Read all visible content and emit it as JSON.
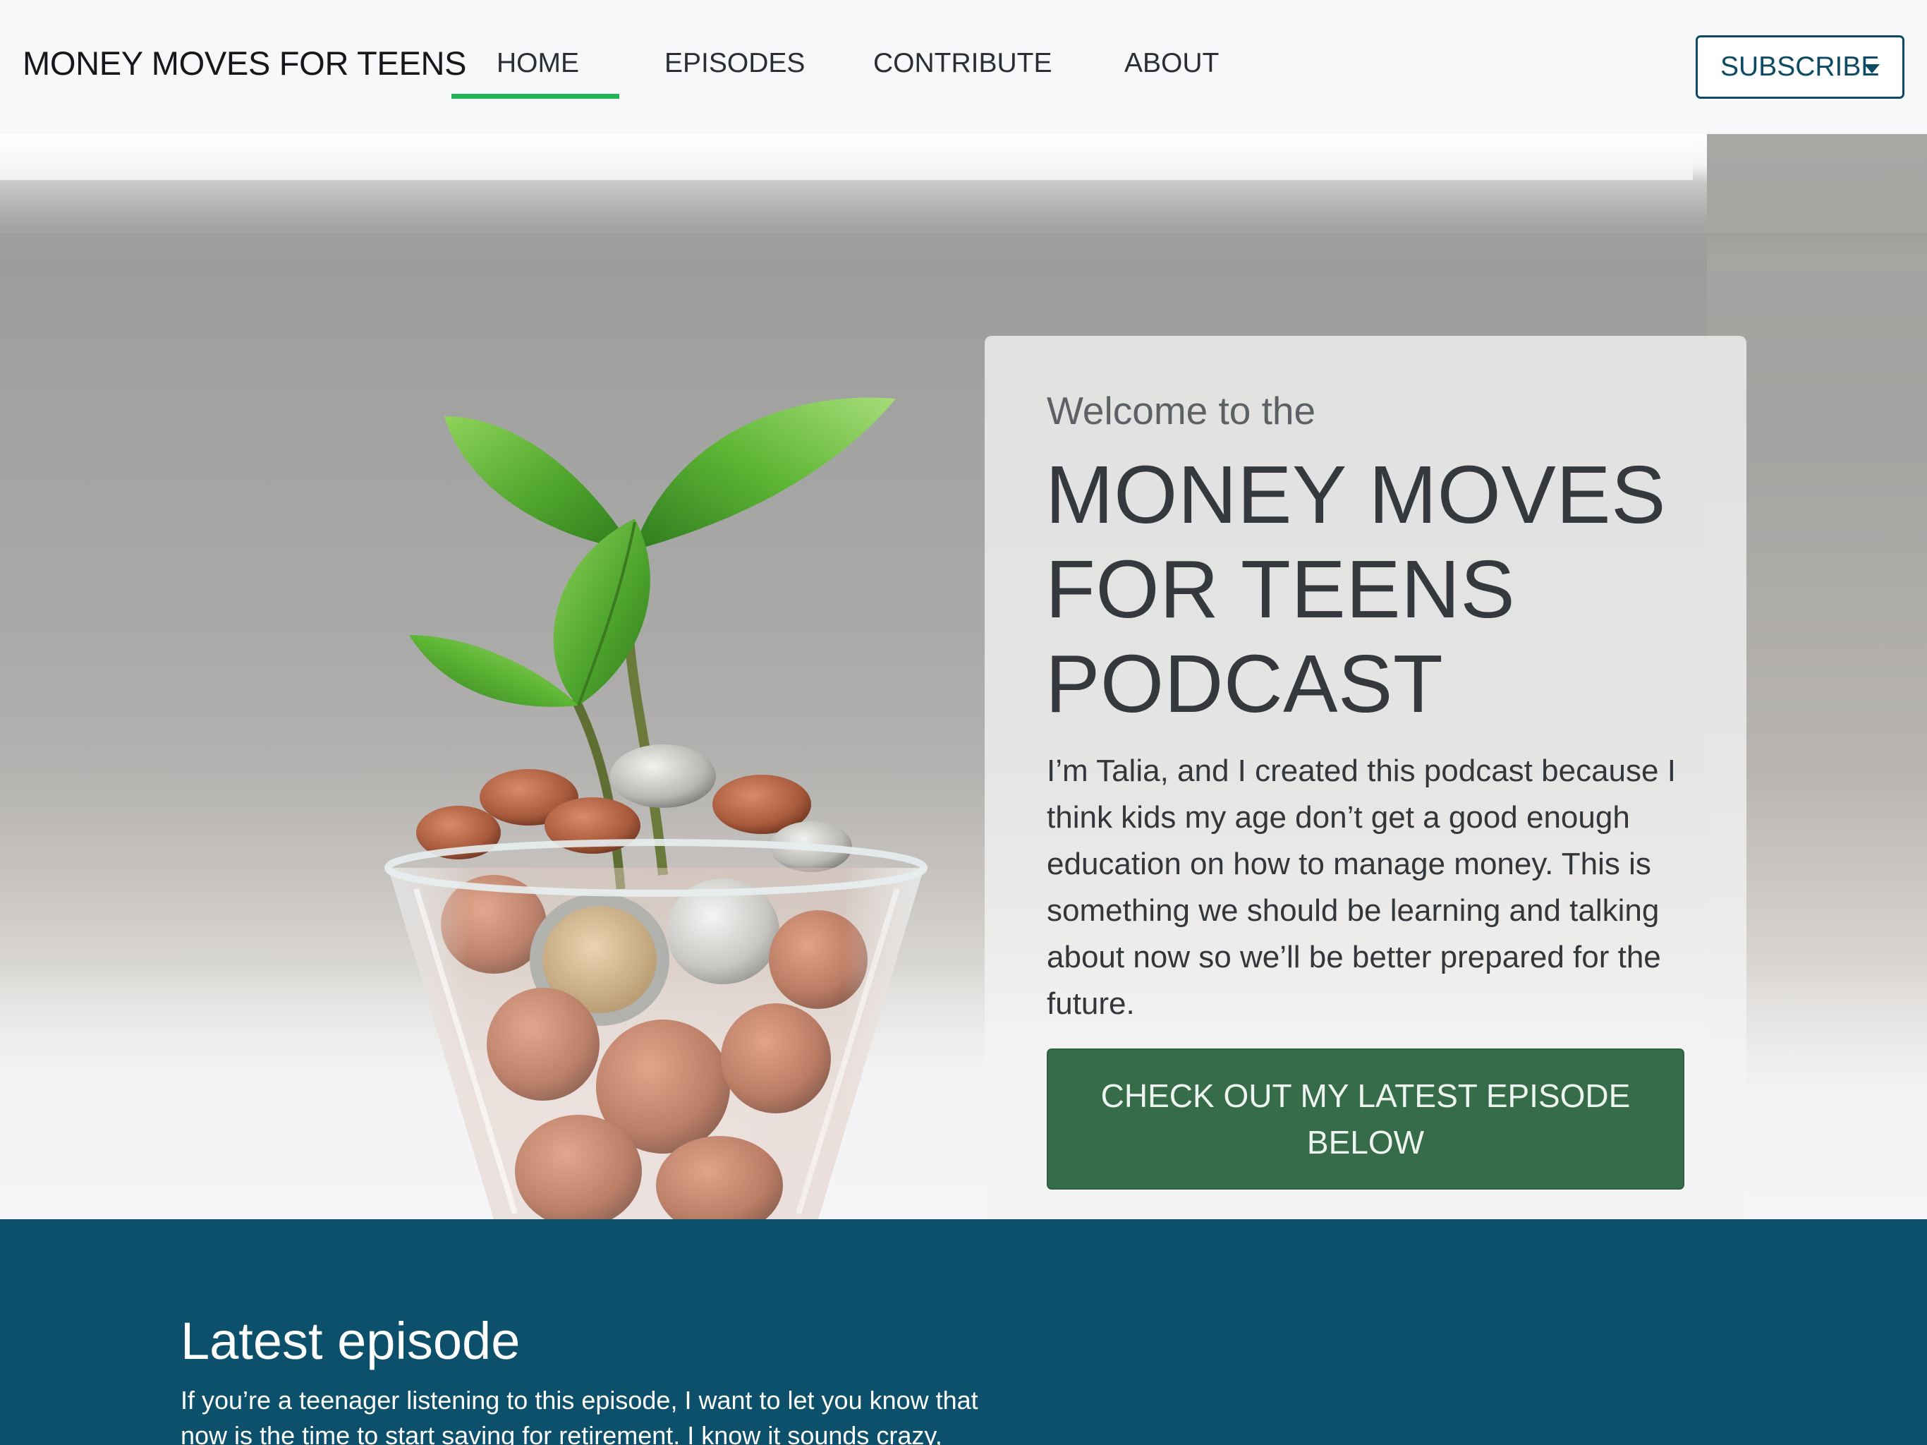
{
  "navbar": {
    "brand": "MONEY MOVES FOR TEENS",
    "links": [
      "HOME",
      "EPISODES",
      "CONTRIBUTE",
      "ABOUT"
    ],
    "active": "HOME",
    "subscribe_label": "SUBSCRIBE"
  },
  "hero": {
    "welcome": "Welcome to the",
    "title_lines": [
      "MONEY MOVES",
      "FOR TEENS",
      "PODCAST"
    ],
    "description": "I’m Talia, and I created this podcast because I think kids my age don’t get a good enough education on how to manage money. This is something we should be learning and talking about now so we’ll be better prepared for the future.",
    "cta_label": "CHECK OUT MY LATEST EPISODE BELOW",
    "image_icon": "plant-growing-from-coins-jar"
  },
  "latest_episode": {
    "heading": "Latest episode",
    "text": "If you’re a teenager listening to this episode, I want to let you know that now is the time to start saving for retirement. I know it sounds crazy,"
  },
  "colors": {
    "accent_underline": "#22b45a",
    "subscribe": "#0d4a63",
    "cta": "#376c4a",
    "section_bg": "#0c506b"
  }
}
